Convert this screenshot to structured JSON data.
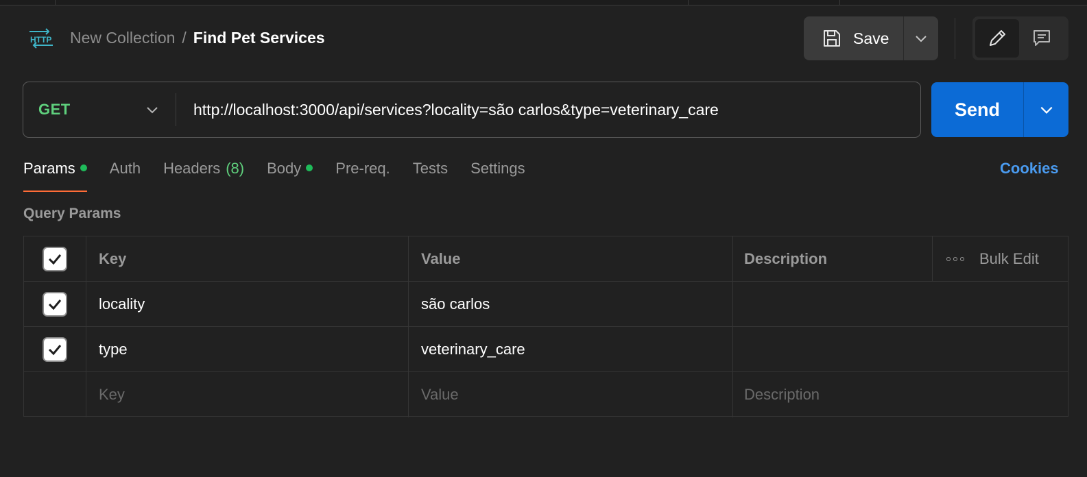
{
  "breadcrumb": {
    "parent": "New Collection",
    "separator": "/",
    "current": "Find Pet Services"
  },
  "toolbar": {
    "save_label": "Save"
  },
  "request": {
    "method": "GET",
    "url": "http://localhost:3000/api/services?locality=são carlos&type=veterinary_care",
    "send_label": "Send"
  },
  "tabs": [
    {
      "label": "Params",
      "active": true,
      "dot": true
    },
    {
      "label": "Auth"
    },
    {
      "label": "Headers",
      "count": "(8)"
    },
    {
      "label": "Body",
      "dot": true
    },
    {
      "label": "Pre-req."
    },
    {
      "label": "Tests"
    },
    {
      "label": "Settings"
    }
  ],
  "cookies_label": "Cookies",
  "query_params": {
    "title": "Query Params",
    "columns": {
      "key": "Key",
      "value": "Value",
      "description": "Description",
      "bulk_edit": "Bulk Edit"
    },
    "rows": [
      {
        "checked": true,
        "key": "locality",
        "value": "são carlos",
        "description": ""
      },
      {
        "checked": true,
        "key": "type",
        "value": "veterinary_care",
        "description": ""
      }
    ],
    "placeholders": {
      "key": "Key",
      "value": "Value",
      "description": "Description"
    }
  },
  "colors": {
    "background": "#212121",
    "method_get": "#5fd07d",
    "send_button": "#0c6bd6",
    "active_tab_underline": "#ff6c37",
    "status_dot": "#1fbb5a",
    "link": "#4a9bf0"
  },
  "icons": {
    "request_type": "http-icon",
    "save": "floppy-disk-icon",
    "edit": "pencil-icon",
    "comments": "comment-icon",
    "dropdown": "chevron-down-icon",
    "more": "more-horizontal-icon",
    "checkbox": "checkmark-icon"
  }
}
